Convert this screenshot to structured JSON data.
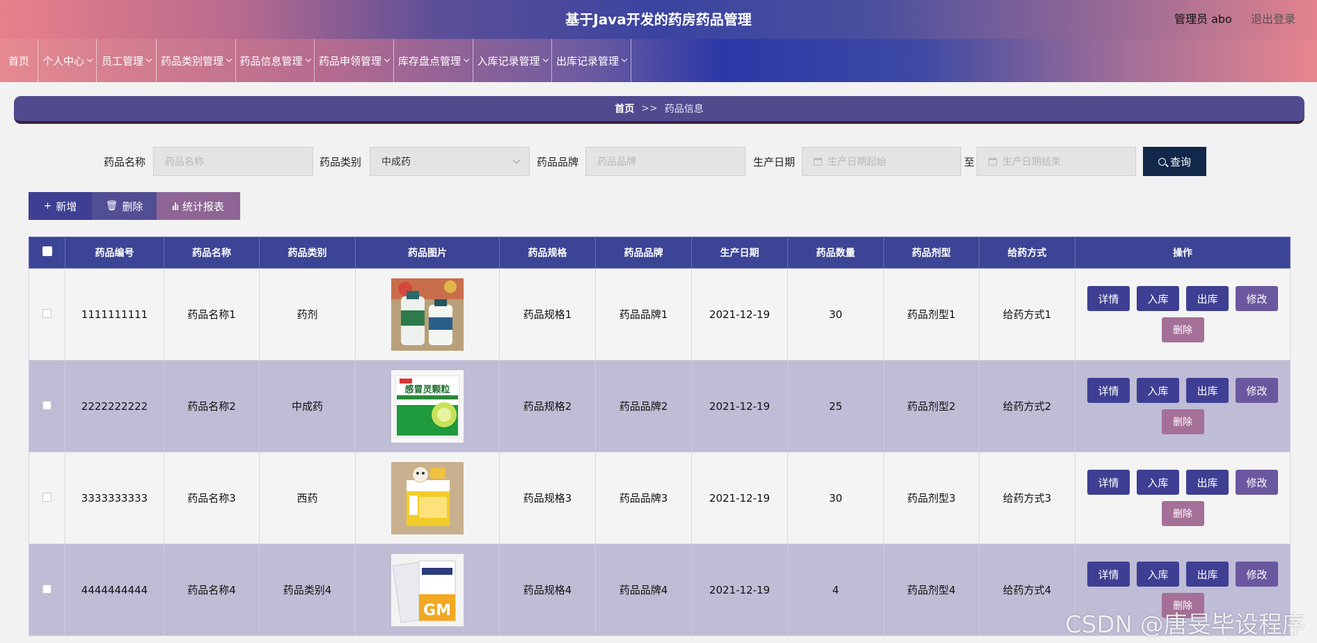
{
  "header": {
    "title": "基于Java开发的药房药品管理",
    "user": "管理员 abo",
    "logout": "退出登录"
  },
  "nav": [
    {
      "label": "首页",
      "dropdown": false
    },
    {
      "label": "个人中心",
      "dropdown": true
    },
    {
      "label": "员工管理",
      "dropdown": true
    },
    {
      "label": "药品类别管理",
      "dropdown": true
    },
    {
      "label": "药品信息管理",
      "dropdown": true
    },
    {
      "label": "药品申领管理",
      "dropdown": true
    },
    {
      "label": "库存盘点管理",
      "dropdown": true
    },
    {
      "label": "入库记录管理",
      "dropdown": true
    },
    {
      "label": "出库记录管理",
      "dropdown": true
    }
  ],
  "breadcrumb": {
    "home": "首页",
    "sep": ">>",
    "current": "药品信息"
  },
  "search": {
    "name_label": "药品名称",
    "name_placeholder": "药品名称",
    "type_label": "药品类别",
    "type_value": "中成药",
    "brand_label": "药品品牌",
    "brand_placeholder": "药品品牌",
    "date_label": "生产日期",
    "date_start_placeholder": "生产日期起始",
    "to_label": "至",
    "date_end_placeholder": "生产日期结束",
    "query_button": "查询"
  },
  "actions": {
    "add": "新增",
    "delete": "删除",
    "report": "统计报表"
  },
  "table": {
    "columns": [
      "药品编号",
      "药品名称",
      "药品类别",
      "药品图片",
      "药品规格",
      "药品品牌",
      "生产日期",
      "药品数量",
      "药品剂型",
      "给药方式",
      "操作"
    ],
    "rows": [
      {
        "id": "1111111111",
        "name": "药品名称1",
        "category": "药剂",
        "spec": "药品规格1",
        "brand": "药品品牌1",
        "date": "2021-12-19",
        "qty": "30",
        "form": "药品剂型1",
        "route": "给药方式1"
      },
      {
        "id": "2222222222",
        "name": "药品名称2",
        "category": "中成药",
        "spec": "药品规格2",
        "brand": "药品品牌2",
        "date": "2021-12-19",
        "qty": "25",
        "form": "药品剂型2",
        "route": "给药方式2"
      },
      {
        "id": "3333333333",
        "name": "药品名称3",
        "category": "西药",
        "spec": "药品规格3",
        "brand": "药品品牌3",
        "date": "2021-12-19",
        "qty": "30",
        "form": "药品剂型3",
        "route": "给药方式3"
      },
      {
        "id": "4444444444",
        "name": "药品名称4",
        "category": "药品类别4",
        "spec": "药品规格4",
        "brand": "药品品牌4",
        "date": "2021-12-19",
        "qty": "4",
        "form": "药品剂型4",
        "route": "给药方式4"
      }
    ],
    "row_buttons": {
      "detail": "详情",
      "in": "入库",
      "out": "出库",
      "edit": "修改",
      "delete": "删除"
    }
  },
  "images": {
    "img1_text": "",
    "img2_text": "感冒灵颗粒",
    "img4_text": "GM"
  },
  "watermark": "CSDN @唐旻毕设程序"
}
